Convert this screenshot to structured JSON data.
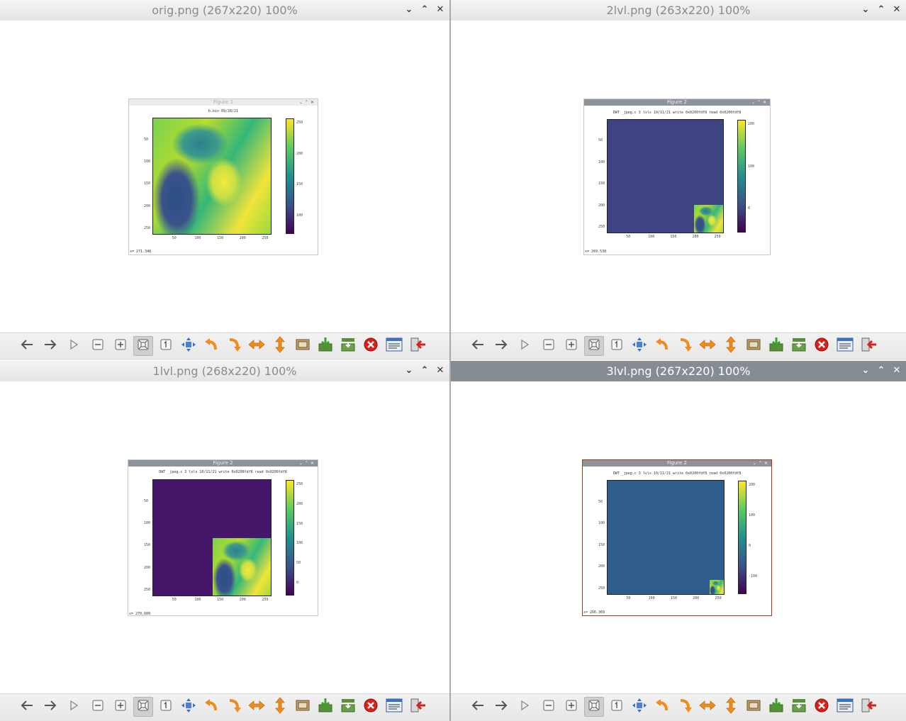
{
  "windows": {
    "orig": {
      "title": "orig.png (267x220) 100%",
      "figure": {
        "title": "Figure 1",
        "plot_title": "b.bin 09/28/21",
        "status": "x= 271.348",
        "yticks": [
          "50",
          "100",
          "150",
          "200",
          "250"
        ],
        "xticks": [
          "50",
          "100",
          "150",
          "200",
          "250"
        ],
        "cbticks": [
          "250",
          "200",
          "150",
          "100"
        ]
      }
    },
    "lvl2": {
      "title": "2lvl.png (263x220) 100%",
      "figure": {
        "title": "Figure 2",
        "plot_title": "DWT _jpeg.c 3 lvls 10/11/21 write 0x0200fdf8 read 0x0200fdf8",
        "status": "x= 269.538",
        "yticks": [
          "50",
          "100",
          "150",
          "200",
          "250"
        ],
        "xticks": [
          "50",
          "100",
          "150",
          "200",
          "250"
        ],
        "cbticks": [
          "200",
          "100",
          "0"
        ]
      }
    },
    "lvl1": {
      "title": "1lvl.png (268x220) 100%",
      "figure": {
        "title": "Figure 2",
        "plot_title": "DWT _jpeg.c 3 lvls 10/11/21 write 0x0200fdf8 read 0x0200fdf8",
        "status": "x= 270.600",
        "yticks": [
          "50",
          "100",
          "150",
          "200",
          "250"
        ],
        "xticks": [
          "50",
          "100",
          "150",
          "200",
          "250"
        ],
        "cbticks": [
          "250",
          "200",
          "150",
          "100",
          "50",
          "0"
        ]
      }
    },
    "lvl3": {
      "title": "3lvl.png (267x220) 100%",
      "figure": {
        "title": "Figure 2",
        "plot_title": "DWT _jpeg.c 3 lvls 10/11/21 write 0x0200fdf8 read 0x0200fdf8",
        "status": "x= 266.369",
        "yticks": [
          "50",
          "100",
          "150",
          "200",
          "250"
        ],
        "xticks": [
          "50",
          "100",
          "150",
          "200",
          "250"
        ],
        "cbticks": [
          "200",
          "100",
          "0",
          "-100"
        ]
      }
    }
  },
  "window_controls": {
    "minimize": "⌄",
    "maximize": "⌃",
    "close": "✕"
  },
  "toolbar_icons": [
    "back-arrow-icon",
    "forward-arrow-icon",
    "play-slideshow-icon",
    "zoom-out-icon",
    "zoom-in-icon",
    "zoom-fit-icon",
    "zoom-original-icon",
    "fullscreen-icon",
    "rotate-left-icon",
    "rotate-right-icon",
    "flip-horizontal-icon",
    "flip-vertical-icon",
    "open-file-icon",
    "save-icon",
    "save-as-icon",
    "delete-icon",
    "preferences-icon",
    "exit-icon"
  ],
  "colors": {
    "viridis_dark": "#440154",
    "viridis_blue": "#3b528b",
    "viridis_teal": "#21918c",
    "viridis_green": "#5ec962",
    "viridis_yellow": "#fde725",
    "active_titlebar": "#858c94",
    "orange_icon": "#f08c1e",
    "delete_red": "#d9201a"
  }
}
